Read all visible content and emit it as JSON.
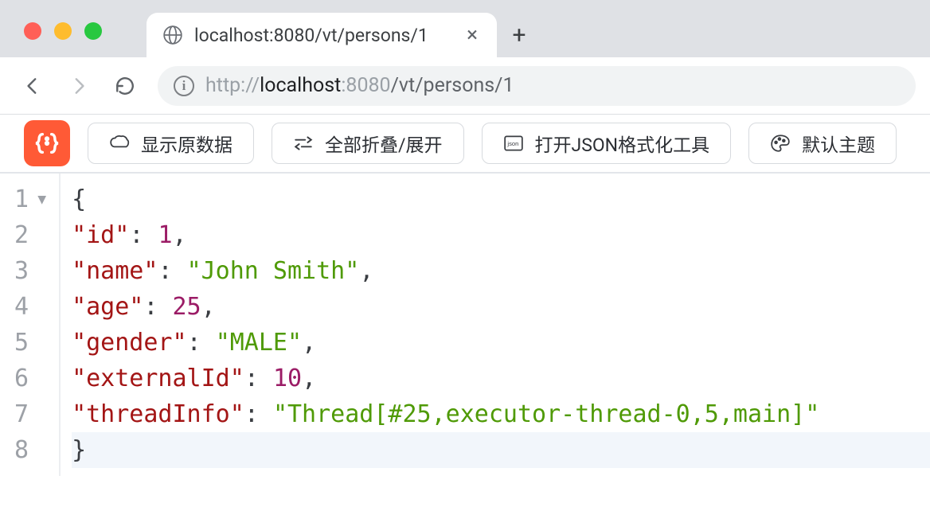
{
  "window": {
    "tab_title": "localhost:8080/vt/persons/1"
  },
  "address": {
    "protocol": "http://",
    "host": "localhost",
    "port": ":8080",
    "path": "/vt/persons/1"
  },
  "ext_buttons": {
    "raw": "显示原数据",
    "fold": "全部折叠/展开",
    "tool": "打开JSON格式化工具",
    "theme": "默认主题"
  },
  "gutter": {
    "l1": "1",
    "l2": "2",
    "l3": "3",
    "l4": "4",
    "l5": "5",
    "l6": "6",
    "l7": "7",
    "l8": "8"
  },
  "json": {
    "open_brace": "{",
    "close_brace": "}",
    "k_id": "\"id\"",
    "v_id": "1",
    "k_name": "\"name\"",
    "v_name": "\"John Smith\"",
    "k_age": "\"age\"",
    "v_age": "25",
    "k_gender": "\"gender\"",
    "v_gender": "\"MALE\"",
    "k_externalId": "\"externalId\"",
    "v_externalId": "10",
    "k_threadInfo": "\"threadInfo\"",
    "v_threadInfo": "\"Thread[#25,executor-thread-0,5,main]\"",
    "colon": ": ",
    "comma": ","
  }
}
